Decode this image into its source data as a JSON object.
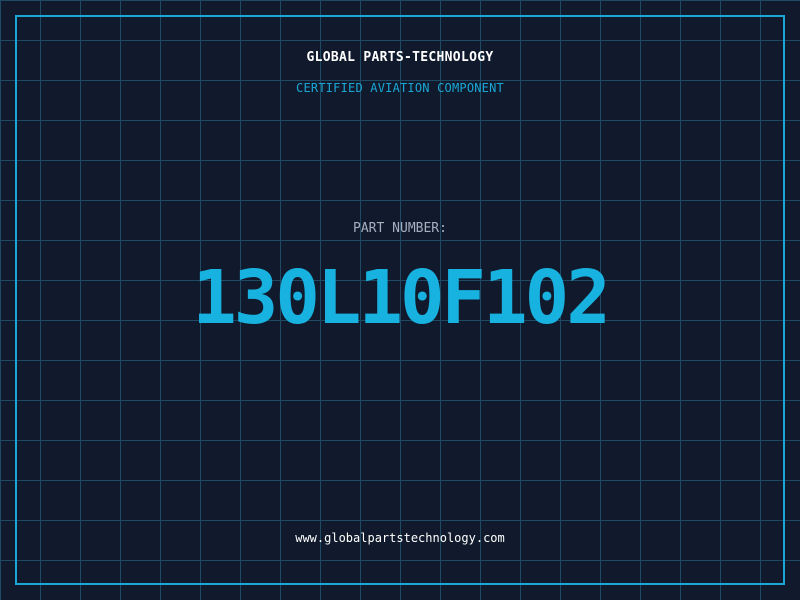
{
  "header": {
    "company_name": "GLOBAL PARTS-TECHNOLOGY",
    "tagline": "CERTIFIED AVIATION COMPONENT"
  },
  "part": {
    "label": "PART NUMBER:",
    "number": "130L10F102"
  },
  "footer": {
    "website": "www.globalpartstechnology.com"
  },
  "colors": {
    "background": "#111a2c",
    "grid": "#1f4a63",
    "accent": "#18b2e0",
    "text": "#ffffff",
    "muted": "#a6b0bf"
  }
}
